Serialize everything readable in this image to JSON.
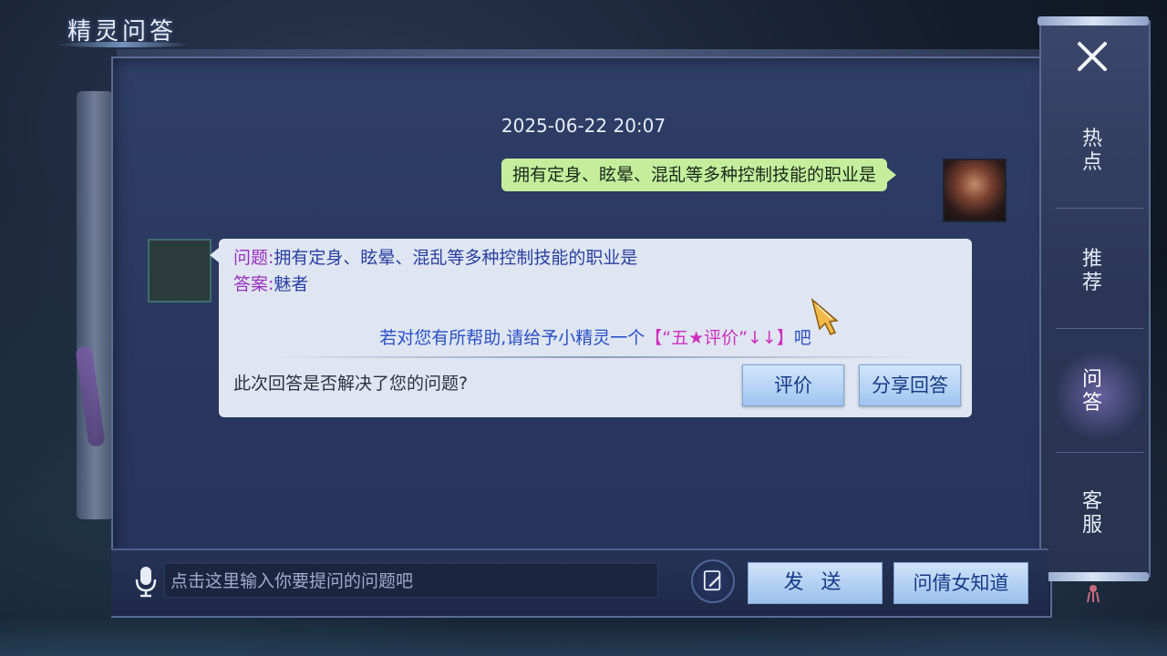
{
  "header": {
    "title": "精灵问答"
  },
  "chat": {
    "timestamp": "2025-06-22 20:07",
    "user_message": "拥有定身、眩晕、混乱等多种控制技能的职业是",
    "answer_card": {
      "question_label": "问题:",
      "question_text": "拥有定身、眩晕、混乱等多种控制技能的职业是",
      "answer_label": "答案:",
      "answer_text": "魅者",
      "help_prefix": "若对您有所帮助,请给予小精灵一个",
      "help_highlight": "【“五★评价”↓↓】",
      "help_suffix": "吧",
      "resolved_question": "此次回答是否解决了您的问题?",
      "rate_button": "评价",
      "share_button": "分享回答"
    }
  },
  "right_nav": {
    "items": [
      {
        "label_line1": "热",
        "label_line2": "点"
      },
      {
        "label_line1": "推",
        "label_line2": "荐"
      },
      {
        "label_line1": "问",
        "label_line2": "答"
      },
      {
        "label_line1": "客",
        "label_line2": "服"
      }
    ],
    "active_index": 2
  },
  "input_bar": {
    "placeholder": "点击这里输入你要提问的问题吧",
    "send_button": "发 送",
    "ask_button": "问倩女知道"
  },
  "colors": {
    "user_bubble": "#c4ee9c",
    "bot_bubble": "#dfe6f2",
    "label_purple": "#9a2fc0",
    "text_blue": "#2a3fa2",
    "highlight_pink": "#cf2fbf"
  },
  "icons": [
    "close-icon",
    "mic-icon",
    "edit-note-icon",
    "pointer-cursor-icon",
    "tassel-icon"
  ]
}
